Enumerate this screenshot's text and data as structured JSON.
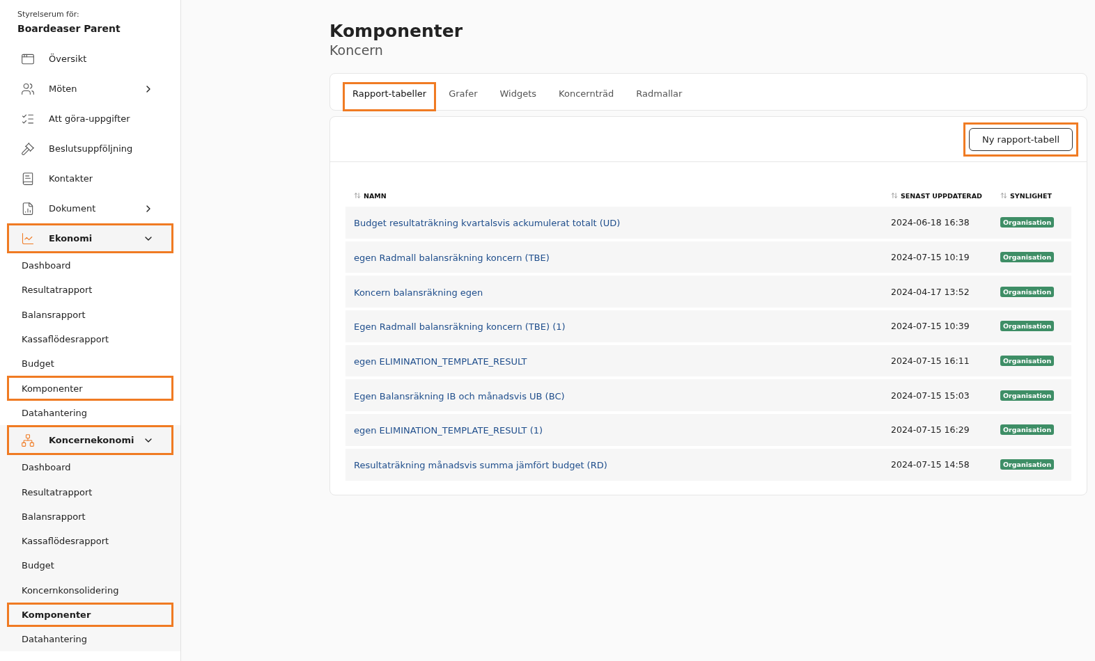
{
  "sidebar": {
    "caption": "Styrelserum för:",
    "org": "Boardeaser Parent",
    "items": [
      {
        "label": "Översikt",
        "highlighted": false
      },
      {
        "label": "Möten",
        "expanded": false,
        "highlighted": false
      },
      {
        "label": "Att göra-uppgifter",
        "highlighted": false
      },
      {
        "label": "Beslutsuppföljning",
        "highlighted": false
      },
      {
        "label": "Kontakter",
        "highlighted": false
      },
      {
        "label": "Dokument",
        "expanded": false,
        "highlighted": false
      },
      {
        "label": "Ekonomi",
        "expanded": true,
        "highlighted": true,
        "children": [
          {
            "label": "Dashboard",
            "selected": false,
            "highlighted": false
          },
          {
            "label": "Resultatrapport",
            "selected": false,
            "highlighted": false
          },
          {
            "label": "Balansrapport",
            "selected": false,
            "highlighted": false
          },
          {
            "label": "Kassaflödesrapport",
            "selected": false,
            "highlighted": false
          },
          {
            "label": "Budget",
            "selected": false,
            "highlighted": false
          },
          {
            "label": "Komponenter",
            "selected": false,
            "highlighted": true
          },
          {
            "label": "Datahantering",
            "selected": false,
            "highlighted": false
          }
        ]
      },
      {
        "label": "Koncernekonomi",
        "expanded": true,
        "highlighted": true,
        "children": [
          {
            "label": "Dashboard",
            "selected": false,
            "highlighted": false
          },
          {
            "label": "Resultatrapport",
            "selected": false,
            "highlighted": false
          },
          {
            "label": "Balansrapport",
            "selected": false,
            "highlighted": false
          },
          {
            "label": "Kassaflödesrapport",
            "selected": false,
            "highlighted": false
          },
          {
            "label": "Budget",
            "selected": false,
            "highlighted": false
          },
          {
            "label": "Koncernkonsolidering",
            "selected": false,
            "highlighted": false
          },
          {
            "label": "Komponenter",
            "selected": true,
            "highlighted": true
          },
          {
            "label": "Datahantering",
            "selected": false,
            "highlighted": false
          }
        ]
      }
    ]
  },
  "page": {
    "title": "Komponenter",
    "subtitle": "Koncern"
  },
  "tabs": [
    {
      "label": "Rapport-tabeller",
      "selected": true,
      "highlighted": true
    },
    {
      "label": "Grafer",
      "selected": false,
      "highlighted": false
    },
    {
      "label": "Widgets",
      "selected": false,
      "highlighted": false
    },
    {
      "label": "Koncernträd",
      "selected": false,
      "highlighted": false
    },
    {
      "label": "Radmallar",
      "selected": false,
      "highlighted": false
    }
  ],
  "new_button": {
    "label": "Ny rapport-tabell",
    "highlighted": true
  },
  "table": {
    "columns": [
      "NAMN",
      "SENAST UPPDATERAD",
      "SYNLIGHET"
    ],
    "rows": [
      {
        "name": "Budget resultaträkning kvartalsvis ackumulerat totalt (UD)",
        "updated": "2024-06-18 16:38",
        "visibility": "Organisation"
      },
      {
        "name": "egen Radmall balansräkning koncern (TBE)",
        "updated": "2024-07-15 10:19",
        "visibility": "Organisation"
      },
      {
        "name": "Koncern balansräkning egen",
        "updated": "2024-04-17 13:52",
        "visibility": "Organisation"
      },
      {
        "name": "Egen Radmall balansräkning koncern (TBE) (1)",
        "updated": "2024-07-15 10:39",
        "visibility": "Organisation"
      },
      {
        "name": "egen ELIMINATION_TEMPLATE_RESULT",
        "updated": "2024-07-15 16:11",
        "visibility": "Organisation"
      },
      {
        "name": "Egen Balansräkning IB och månadsvis UB (BC)",
        "updated": "2024-07-15 15:03",
        "visibility": "Organisation"
      },
      {
        "name": "egen ELIMINATION_TEMPLATE_RESULT (1)",
        "updated": "2024-07-15 16:29",
        "visibility": "Organisation"
      },
      {
        "name": "Resultaträkning månadsvis summa jämfört budget (RD)",
        "updated": "2024-07-15 14:58",
        "visibility": "Organisation"
      }
    ]
  }
}
